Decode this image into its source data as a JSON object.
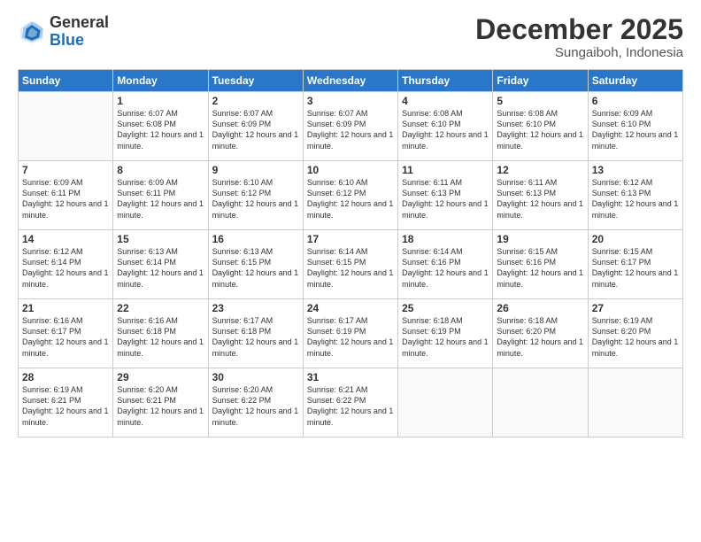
{
  "logo": {
    "general": "General",
    "blue": "Blue"
  },
  "header": {
    "month_year": "December 2025",
    "location": "Sungaiboh, Indonesia"
  },
  "weekdays": [
    "Sunday",
    "Monday",
    "Tuesday",
    "Wednesday",
    "Thursday",
    "Friday",
    "Saturday"
  ],
  "weeks": [
    [
      {
        "day": "",
        "info": ""
      },
      {
        "day": "1",
        "info": "Sunrise: 6:07 AM\nSunset: 6:08 PM\nDaylight: 12 hours and 1 minute."
      },
      {
        "day": "2",
        "info": "Sunrise: 6:07 AM\nSunset: 6:09 PM\nDaylight: 12 hours and 1 minute."
      },
      {
        "day": "3",
        "info": "Sunrise: 6:07 AM\nSunset: 6:09 PM\nDaylight: 12 hours and 1 minute."
      },
      {
        "day": "4",
        "info": "Sunrise: 6:08 AM\nSunset: 6:10 PM\nDaylight: 12 hours and 1 minute."
      },
      {
        "day": "5",
        "info": "Sunrise: 6:08 AM\nSunset: 6:10 PM\nDaylight: 12 hours and 1 minute."
      },
      {
        "day": "6",
        "info": "Sunrise: 6:09 AM\nSunset: 6:10 PM\nDaylight: 12 hours and 1 minute."
      }
    ],
    [
      {
        "day": "7",
        "info": "Sunrise: 6:09 AM\nSunset: 6:11 PM\nDaylight: 12 hours and 1 minute."
      },
      {
        "day": "8",
        "info": "Sunrise: 6:09 AM\nSunset: 6:11 PM\nDaylight: 12 hours and 1 minute."
      },
      {
        "day": "9",
        "info": "Sunrise: 6:10 AM\nSunset: 6:12 PM\nDaylight: 12 hours and 1 minute."
      },
      {
        "day": "10",
        "info": "Sunrise: 6:10 AM\nSunset: 6:12 PM\nDaylight: 12 hours and 1 minute."
      },
      {
        "day": "11",
        "info": "Sunrise: 6:11 AM\nSunset: 6:13 PM\nDaylight: 12 hours and 1 minute."
      },
      {
        "day": "12",
        "info": "Sunrise: 6:11 AM\nSunset: 6:13 PM\nDaylight: 12 hours and 1 minute."
      },
      {
        "day": "13",
        "info": "Sunrise: 6:12 AM\nSunset: 6:13 PM\nDaylight: 12 hours and 1 minute."
      }
    ],
    [
      {
        "day": "14",
        "info": "Sunrise: 6:12 AM\nSunset: 6:14 PM\nDaylight: 12 hours and 1 minute."
      },
      {
        "day": "15",
        "info": "Sunrise: 6:13 AM\nSunset: 6:14 PM\nDaylight: 12 hours and 1 minute."
      },
      {
        "day": "16",
        "info": "Sunrise: 6:13 AM\nSunset: 6:15 PM\nDaylight: 12 hours and 1 minute."
      },
      {
        "day": "17",
        "info": "Sunrise: 6:14 AM\nSunset: 6:15 PM\nDaylight: 12 hours and 1 minute."
      },
      {
        "day": "18",
        "info": "Sunrise: 6:14 AM\nSunset: 6:16 PM\nDaylight: 12 hours and 1 minute."
      },
      {
        "day": "19",
        "info": "Sunrise: 6:15 AM\nSunset: 6:16 PM\nDaylight: 12 hours and 1 minute."
      },
      {
        "day": "20",
        "info": "Sunrise: 6:15 AM\nSunset: 6:17 PM\nDaylight: 12 hours and 1 minute."
      }
    ],
    [
      {
        "day": "21",
        "info": "Sunrise: 6:16 AM\nSunset: 6:17 PM\nDaylight: 12 hours and 1 minute."
      },
      {
        "day": "22",
        "info": "Sunrise: 6:16 AM\nSunset: 6:18 PM\nDaylight: 12 hours and 1 minute."
      },
      {
        "day": "23",
        "info": "Sunrise: 6:17 AM\nSunset: 6:18 PM\nDaylight: 12 hours and 1 minute."
      },
      {
        "day": "24",
        "info": "Sunrise: 6:17 AM\nSunset: 6:19 PM\nDaylight: 12 hours and 1 minute."
      },
      {
        "day": "25",
        "info": "Sunrise: 6:18 AM\nSunset: 6:19 PM\nDaylight: 12 hours and 1 minute."
      },
      {
        "day": "26",
        "info": "Sunrise: 6:18 AM\nSunset: 6:20 PM\nDaylight: 12 hours and 1 minute."
      },
      {
        "day": "27",
        "info": "Sunrise: 6:19 AM\nSunset: 6:20 PM\nDaylight: 12 hours and 1 minute."
      }
    ],
    [
      {
        "day": "28",
        "info": "Sunrise: 6:19 AM\nSunset: 6:21 PM\nDaylight: 12 hours and 1 minute."
      },
      {
        "day": "29",
        "info": "Sunrise: 6:20 AM\nSunset: 6:21 PM\nDaylight: 12 hours and 1 minute."
      },
      {
        "day": "30",
        "info": "Sunrise: 6:20 AM\nSunset: 6:22 PM\nDaylight: 12 hours and 1 minute."
      },
      {
        "day": "31",
        "info": "Sunrise: 6:21 AM\nSunset: 6:22 PM\nDaylight: 12 hours and 1 minute."
      },
      {
        "day": "",
        "info": ""
      },
      {
        "day": "",
        "info": ""
      },
      {
        "day": "",
        "info": ""
      }
    ]
  ]
}
